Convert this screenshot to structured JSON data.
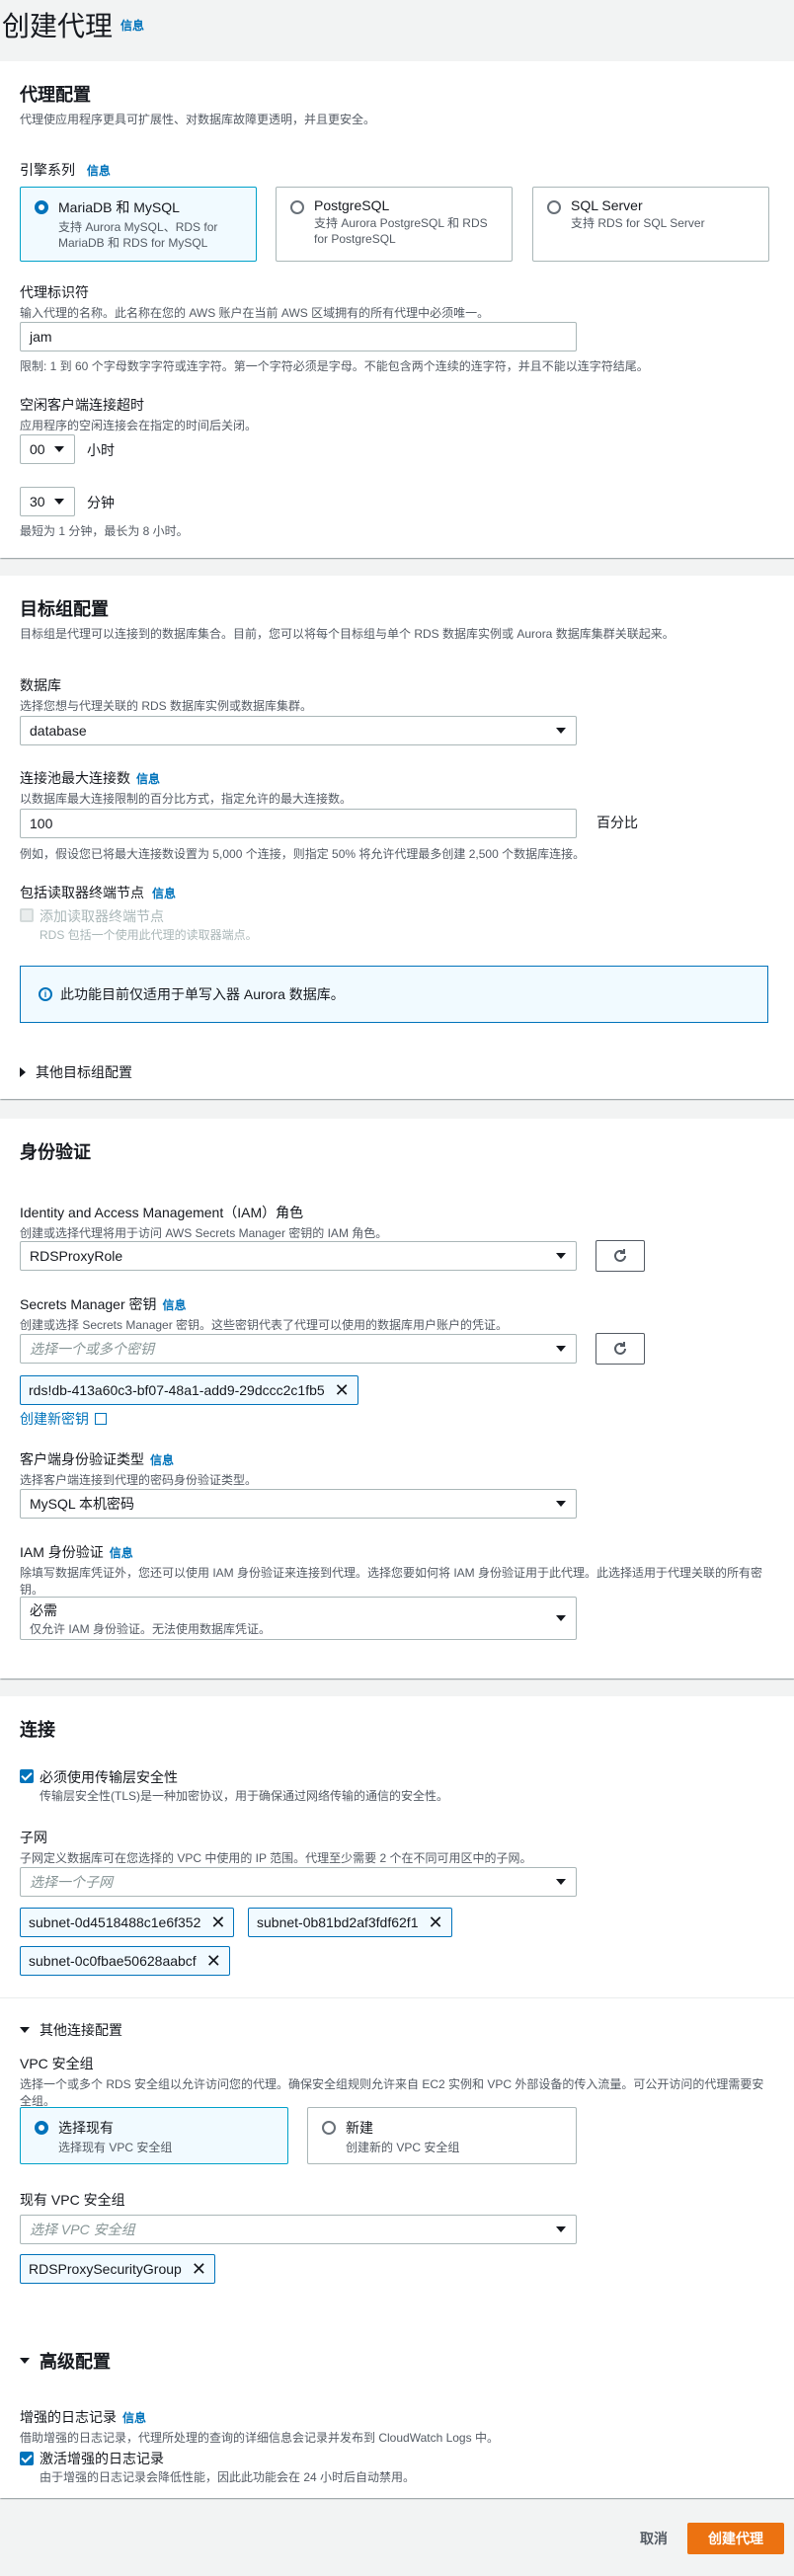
{
  "page": {
    "title": "创建代理",
    "info": "信息"
  },
  "proxy_config": {
    "title": "代理配置",
    "desc": "代理使应用程序更具可扩展性、对数据库故障更透明，并且更安全。",
    "engine": {
      "label": "引擎系列",
      "info": "信息",
      "options": [
        {
          "title": "MariaDB 和 MySQL",
          "desc": "支持 Aurora MySQL、RDS for MariaDB 和 RDS for MySQL",
          "selected": true
        },
        {
          "title": "PostgreSQL",
          "desc": "支持 Aurora PostgreSQL 和 RDS for PostgreSQL",
          "selected": false
        },
        {
          "title": "SQL Server",
          "desc": "支持 RDS for SQL Server",
          "selected": false
        }
      ]
    },
    "identifier": {
      "label": "代理标识符",
      "desc": "输入代理的名称。此名称在您的 AWS 账户在当前 AWS 区域拥有的所有代理中必须唯一。",
      "value": "jam",
      "constraint": "限制: 1 到 60 个字母数字字符或连字符。第一个字符必须是字母。不能包含两个连续的连字符，并且不能以连字符结尾。"
    },
    "idle": {
      "label": "空闲客户端连接超时",
      "desc": "应用程序的空闲连接会在指定的时间后关闭。",
      "hours_value": "00",
      "hours_unit": "小时",
      "minutes_value": "30",
      "minutes_unit": "分钟",
      "hint": "最短为 1 分钟，最长为 8 小时。"
    }
  },
  "target_group": {
    "title": "目标组配置",
    "desc": "目标组是代理可以连接到的数据库集合。目前，您可以将每个目标组与单个 RDS 数据库实例或 Aurora 数据库集群关联起来。",
    "database": {
      "label": "数据库",
      "desc": "选择您想与代理关联的 RDS 数据库实例或数据库集群。",
      "value": "database"
    },
    "pool": {
      "label": "连接池最大连接数",
      "info": "信息",
      "desc": "以数据库最大连接限制的百分比方式，指定允许的最大连接数。",
      "value": "100",
      "suffix": "百分比",
      "example": "例如，假设您已将最大连接数设置为 5,000 个连接，则指定 50% 将允许代理最多创建 2,500 个数据库连接。"
    },
    "reader": {
      "label": "包括读取器终端节点",
      "info": "信息",
      "checkbox_label": "添加读取器终端节点",
      "checkbox_desc": "RDS 包括一个使用此代理的读取器端点。"
    },
    "alert": "此功能目前仅适用于单写入器 Aurora 数据库。",
    "more": "其他目标组配置"
  },
  "auth": {
    "title": "身份验证",
    "iam_role": {
      "label": "Identity and Access Management（IAM）角色",
      "desc": "创建或选择代理将用于访问 AWS Secrets Manager 密钥的 IAM 角色。",
      "value": "RDSProxyRole"
    },
    "secrets": {
      "label": "Secrets Manager 密钥",
      "info": "信息",
      "desc": "创建或选择 Secrets Manager 密钥。这些密钥代表了代理可以使用的数据库用户账户的凭证。",
      "placeholder": "选择一个或多个密钥",
      "token": "rds!db-413a60c3-bf07-48a1-add9-29dccc2c1fb5",
      "create_link": "创建新密钥"
    },
    "client_auth": {
      "label": "客户端身份验证类型",
      "info": "信息",
      "desc": "选择客户端连接到代理的密码身份验证类型。",
      "value": "MySQL 本机密码"
    },
    "iam_auth": {
      "label": "IAM 身份验证",
      "info": "信息",
      "desc": "除填写数据库凭证外，您还可以使用 IAM 身份验证来连接到代理。选择您要如何将 IAM 身份验证用于此代理。此选择适用于代理关联的所有密钥。",
      "value": "必需",
      "value_desc": "仅允许 IAM 身份验证。无法使用数据库凭证。"
    }
  },
  "connectivity": {
    "title": "连接",
    "tls": {
      "label": "必须使用传输层安全性",
      "desc": "传输层安全性(TLS)是一种加密协议，用于确保通过网络传输的通信的安全性。"
    },
    "subnets": {
      "label": "子网",
      "desc": "子网定义数据库可在您选择的 VPC 中使用的 IP 范围。代理至少需要 2 个在不同可用区中的子网。",
      "placeholder": "选择一个子网",
      "tokens": [
        "subnet-0d4518488c1e6f352",
        "subnet-0b81bd2af3fdf62f1",
        "subnet-0c0fbae50628aabcf"
      ]
    },
    "more": "其他连接配置",
    "vpc_sg": {
      "label": "VPC 安全组",
      "desc": "选择一个或多个 RDS 安全组以允许访问您的代理。确保安全组规则允许来自 EC2 实例和 VPC 外部设备的传入流量。可公开访问的代理需要安全组。",
      "options": [
        {
          "title": "选择现有",
          "desc": "选择现有 VPC 安全组",
          "selected": true
        },
        {
          "title": "新建",
          "desc": "创建新的 VPC 安全组",
          "selected": false
        }
      ]
    },
    "existing_sg": {
      "label": "现有 VPC 安全组",
      "placeholder": "选择 VPC 安全组",
      "token": "RDSProxySecurityGroup"
    }
  },
  "advanced": {
    "title": "高级配置",
    "logging": {
      "label": "增强的日志记录",
      "info": "信息",
      "desc": "借助增强的日志记录，代理所处理的查询的详细信息会记录并发布到 CloudWatch Logs 中。",
      "checkbox_label": "激活增强的日志记录",
      "checkbox_desc": "由于增强的日志记录会降低性能，因此此功能会在 24 小时后自动禁用。"
    }
  },
  "footer": {
    "cancel": "取消",
    "create": "创建代理"
  },
  "colors": {
    "primary": "#ec7211",
    "link": "#0073bb",
    "selected_border": "#00a1c9"
  }
}
